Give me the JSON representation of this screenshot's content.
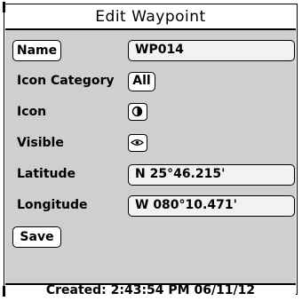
{
  "dialog": {
    "title": "Edit Waypoint",
    "footer_text": "Created: 2:43:54 PM 06/11/12"
  },
  "fields": {
    "name": {
      "button_label": "Name",
      "value": "WP014"
    },
    "icon_category": {
      "label": "Icon Category",
      "value": "All"
    },
    "icon": {
      "label": "Icon",
      "icon": "round-waypoint-icon"
    },
    "visible": {
      "label": "Visible",
      "icon": "eye-icon"
    },
    "latitude": {
      "label": "Latitude",
      "value": "N 25°46.215'"
    },
    "longitude": {
      "label": "Longitude",
      "value": "W 080°10.471'"
    }
  },
  "actions": {
    "save_label": "Save"
  }
}
